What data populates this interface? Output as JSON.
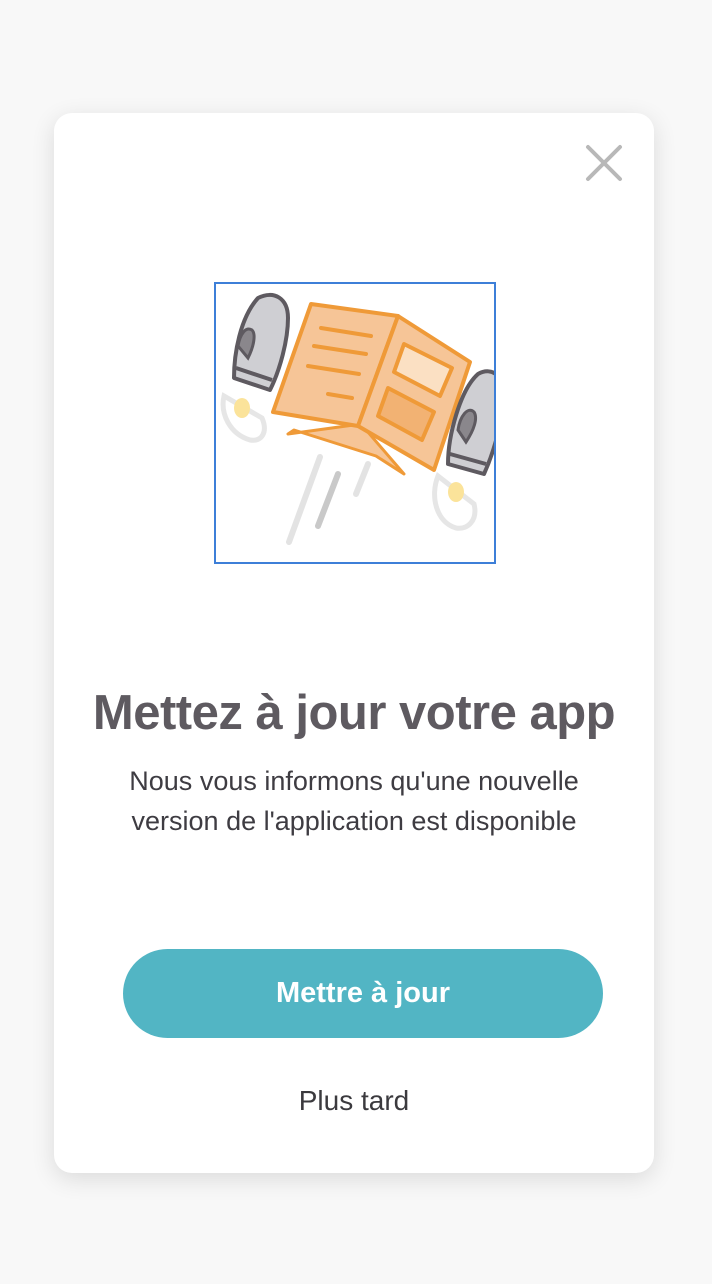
{
  "dialog": {
    "title": "Mettez à jour votre app",
    "message_line1": "Nous vous informons qu'une nouvelle",
    "message_line2": "version de l'application est disponible",
    "primary_button_label": "Mettre à jour",
    "secondary_link_label": "Plus tard",
    "close_icon": "close-icon",
    "illustration": "flying-book-with-rockets"
  },
  "colors": {
    "page_background": "#f8f8f8",
    "card_background": "#ffffff",
    "primary_button": "#52b5c4",
    "title_text": "#5e5a60",
    "body_text": "#3e3c42",
    "illustration_orange": "#ef9a38",
    "illustration_frame": "#3d7fd8"
  }
}
